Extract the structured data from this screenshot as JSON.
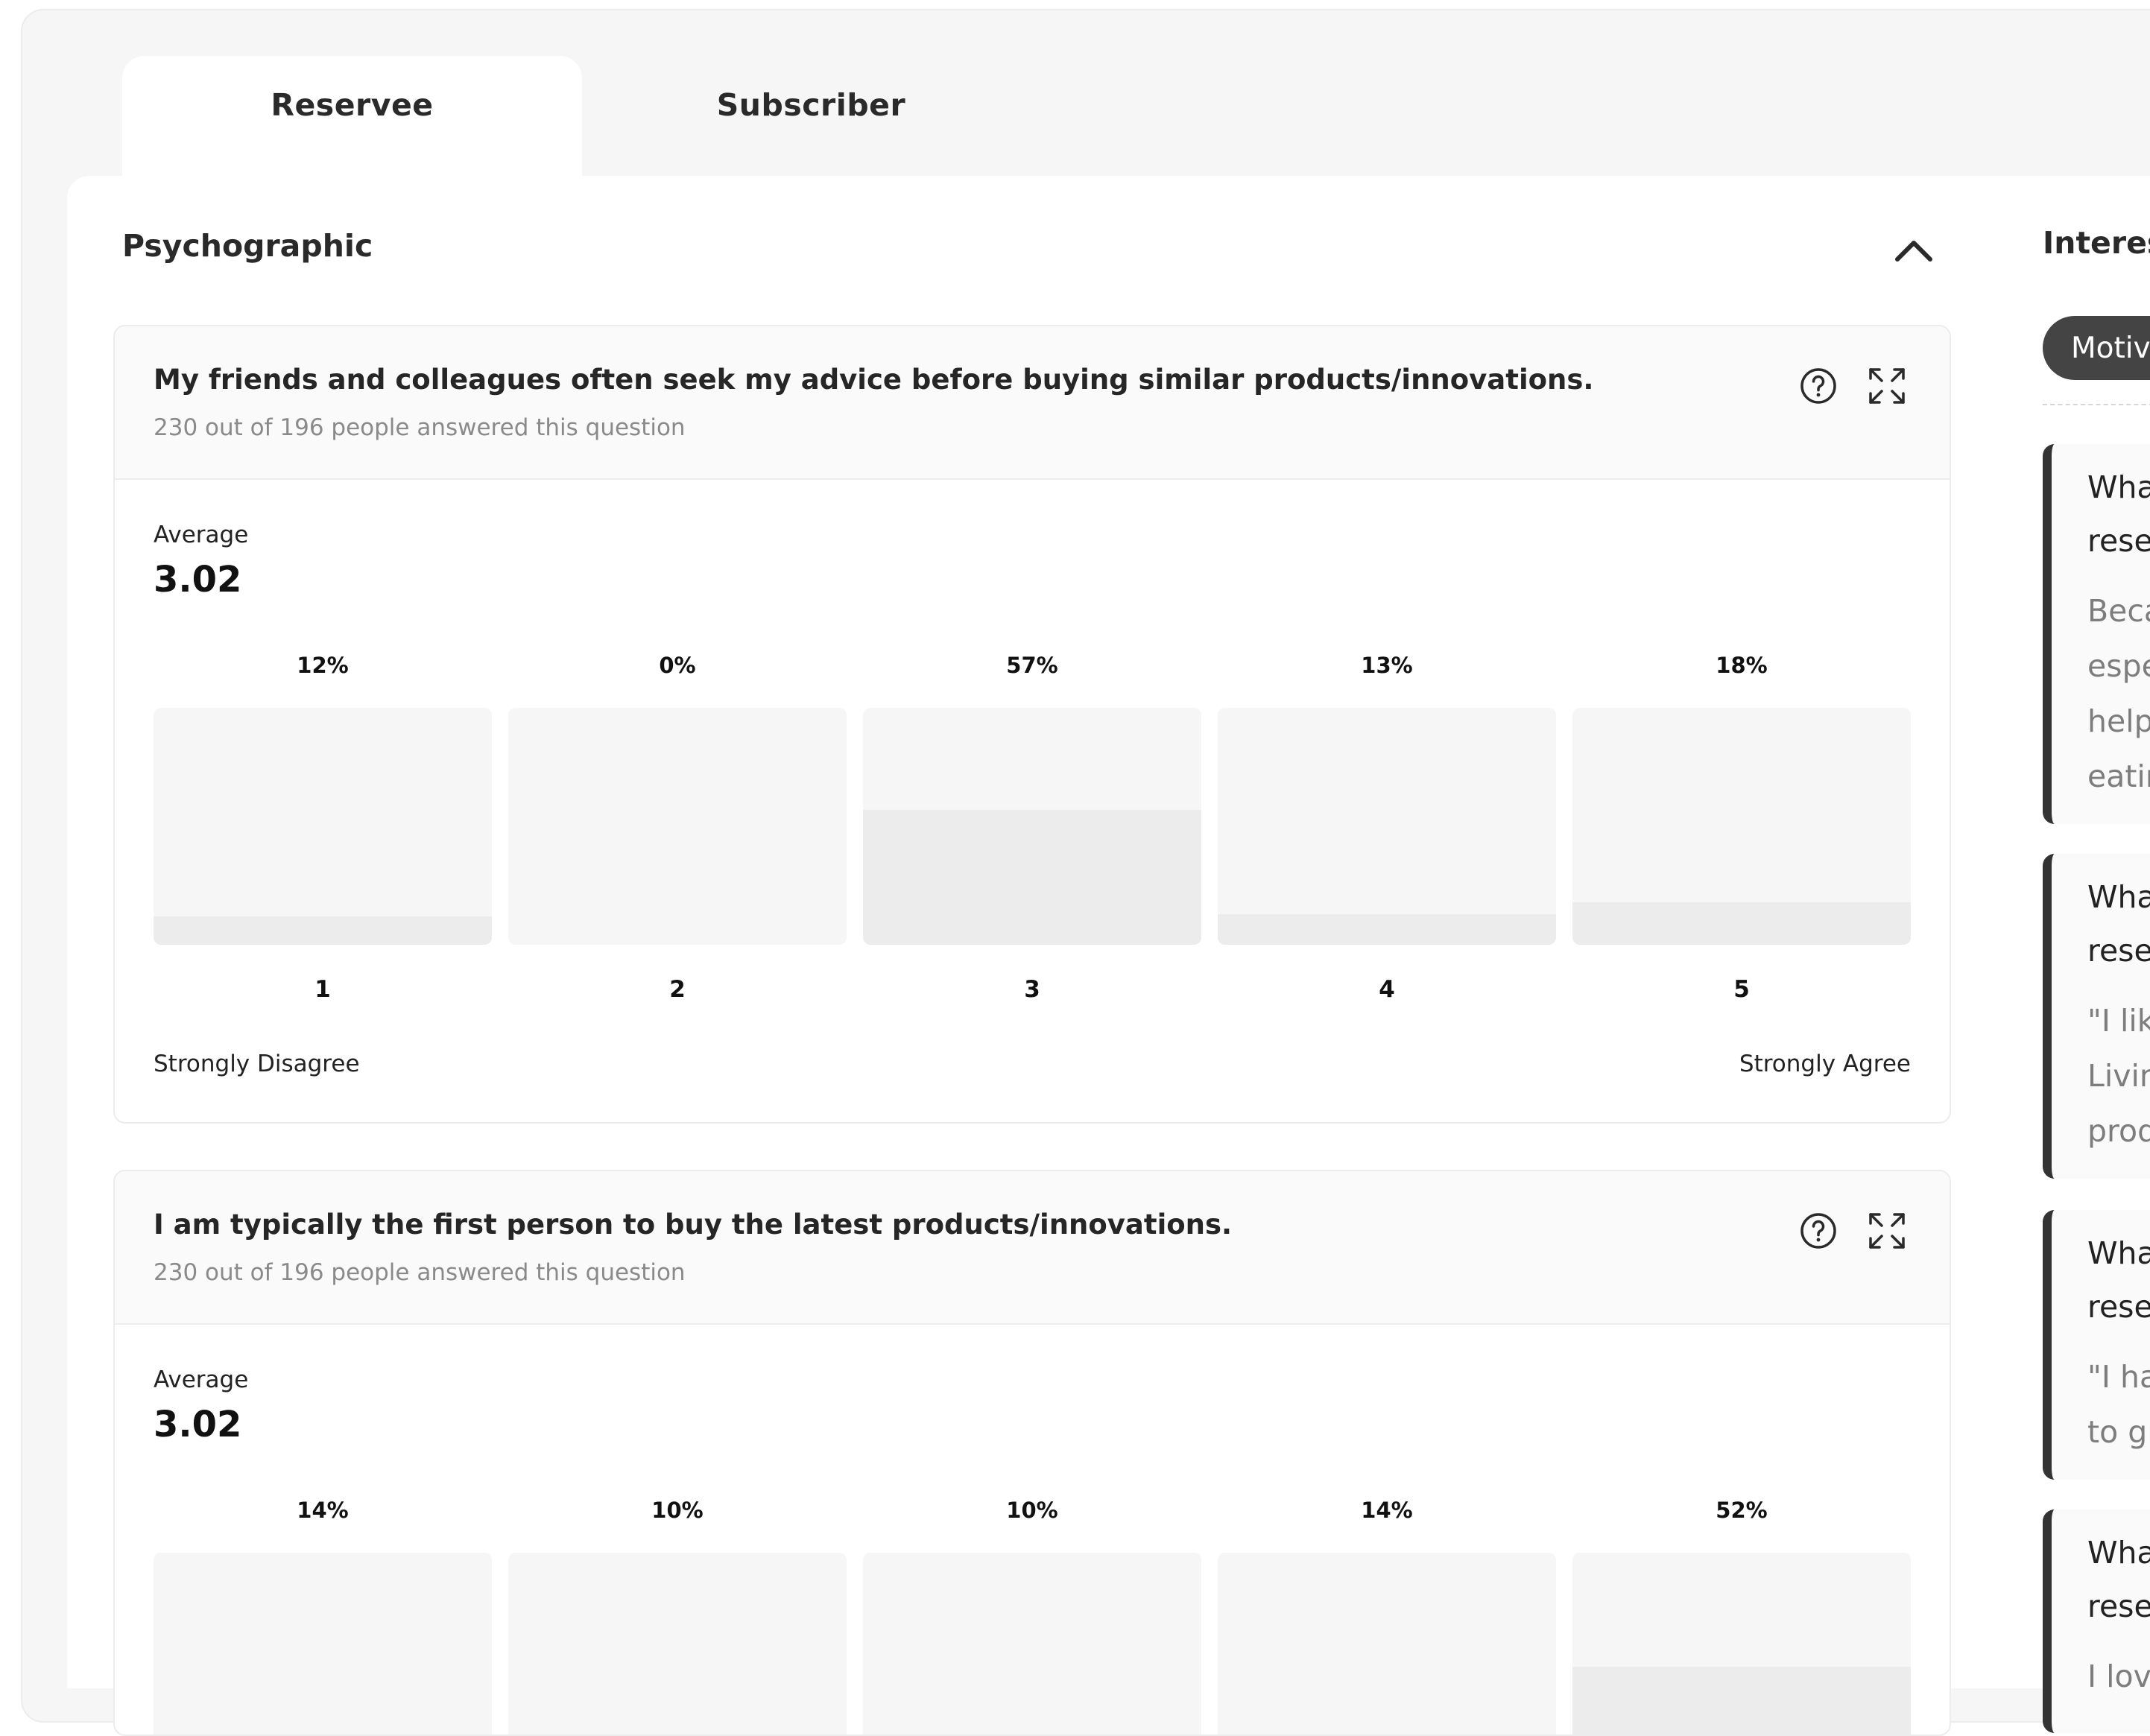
{
  "tabs": [
    {
      "label": "Reservee",
      "active": true
    },
    {
      "label": "Subscriber",
      "active": false
    }
  ],
  "section": {
    "title": "Psychographic"
  },
  "cards": [
    {
      "question": "My friends and colleagues often seek my advice before buying similar products/innovations.",
      "answered": "230 out of 196 people answered this question",
      "average_label": "Average",
      "average": "3.02",
      "bars": [
        {
          "label": "1",
          "pct": "12%",
          "value": 0.12
        },
        {
          "label": "2",
          "pct": "0%",
          "value": 0.0
        },
        {
          "label": "3",
          "pct": "57%",
          "value": 0.57
        },
        {
          "label": "4",
          "pct": "13%",
          "value": 0.13
        },
        {
          "label": "5",
          "pct": "18%",
          "value": 0.18
        }
      ],
      "scale_left": "Strongly Disagree",
      "scale_right": "Strongly Agree"
    },
    {
      "question": "I am typically the first person to buy the latest products/innovations.",
      "answered": "230 out of 196 people answered this question",
      "average_label": "Average",
      "average": "3.02",
      "bars": [
        {
          "label": "1",
          "pct": "14%",
          "value": 0.14
        },
        {
          "label": "2",
          "pct": "10%",
          "value": 0.1
        },
        {
          "label": "3",
          "pct": "10%",
          "value": 0.1
        },
        {
          "label": "4",
          "pct": "14%",
          "value": 0.14
        },
        {
          "label": "5",
          "pct": "52%",
          "value": 0.52
        }
      ]
    }
  ],
  "side": {
    "title": "Interes",
    "pill": "Motiv",
    "cards": [
      {
        "q": [
          "Wha",
          "reser"
        ],
        "a": [
          "Beca",
          "espe",
          "help",
          "eatin"
        ]
      },
      {
        "q": [
          "Wha",
          "reser"
        ],
        "a": [
          "\"I like",
          "Livin",
          "prod"
        ]
      },
      {
        "q": [
          "Wha",
          "reser"
        ],
        "a": [
          "\"I hav",
          "to gr"
        ]
      },
      {
        "q": [
          "Wha",
          "reser"
        ],
        "a": [
          "I love"
        ]
      }
    ]
  },
  "colors": {
    "bar_track": "#f6f6f6",
    "bar_fill": "#ececec",
    "accent_dark": "#444444"
  }
}
